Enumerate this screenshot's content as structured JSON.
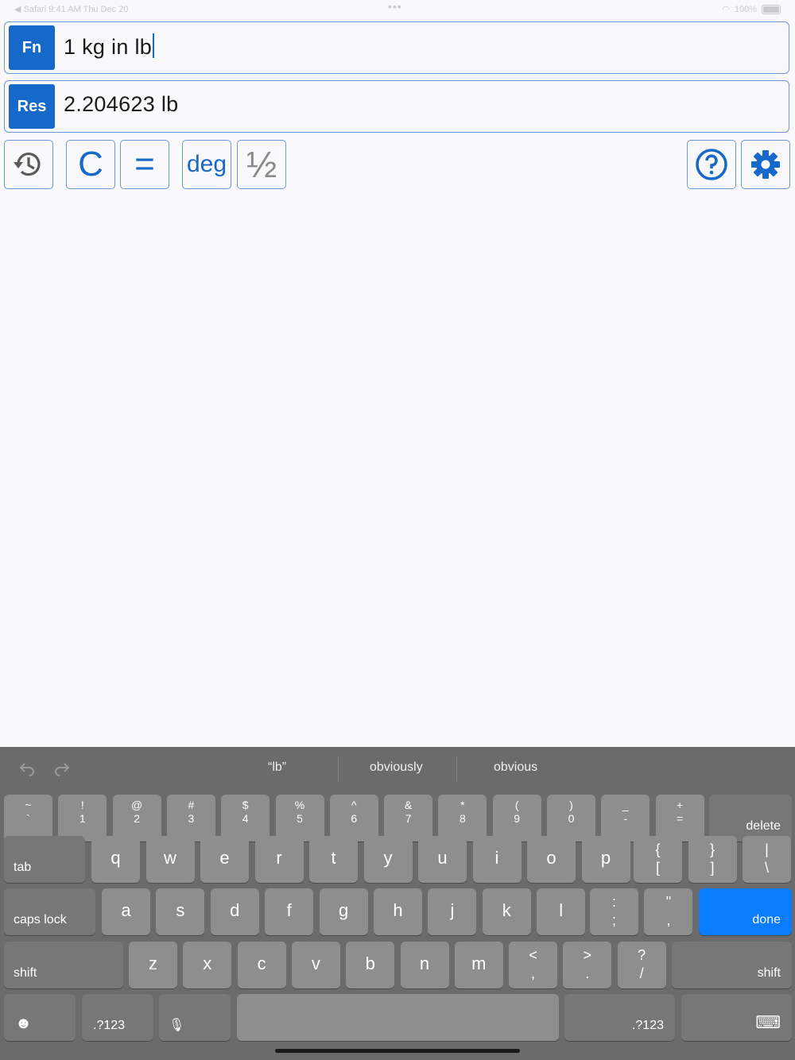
{
  "status": {
    "left": "◀ Safari  9:41 AM   Thu Dec 20",
    "right": "100%"
  },
  "fn": {
    "tag": "Fn",
    "value": "1 kg in lb"
  },
  "res": {
    "tag": "Res",
    "value": "2.204623 lb"
  },
  "toolbar": {
    "clear": "C",
    "equals": "=",
    "deg": "deg",
    "fraction": "½"
  },
  "keyboard": {
    "suggestions": [
      "“lb”",
      "obviously",
      "obvious"
    ],
    "num_row": [
      {
        "t": "~",
        "b": "`"
      },
      {
        "t": "!",
        "b": "1"
      },
      {
        "t": "@",
        "b": "2"
      },
      {
        "t": "#",
        "b": "3"
      },
      {
        "t": "$",
        "b": "4"
      },
      {
        "t": "%",
        "b": "5"
      },
      {
        "t": "^",
        "b": "6"
      },
      {
        "t": "&",
        "b": "7"
      },
      {
        "t": "*",
        "b": "8"
      },
      {
        "t": "(",
        "b": "9"
      },
      {
        "t": ")",
        "b": "0"
      },
      {
        "t": "_",
        "b": "-"
      },
      {
        "t": "+",
        "b": "="
      }
    ],
    "delete": "delete",
    "tab": "tab",
    "row_q": [
      "q",
      "w",
      "e",
      "r",
      "t",
      "y",
      "u",
      "i",
      "o",
      "p"
    ],
    "row_q_punct": [
      {
        "t": "{",
        "b": "["
      },
      {
        "t": "}",
        "b": "]"
      },
      {
        "t": "|",
        "b": "\\"
      }
    ],
    "caps": "caps lock",
    "row_a": [
      "a",
      "s",
      "d",
      "f",
      "g",
      "h",
      "j",
      "k",
      "l"
    ],
    "row_a_punct": [
      {
        "t": ":",
        "b": ";"
      },
      {
        "t": "\"",
        "b": ","
      }
    ],
    "done": "done",
    "shift": "shift",
    "row_z": [
      "z",
      "x",
      "c",
      "v",
      "b",
      "n",
      "m"
    ],
    "row_z_punct": [
      {
        "t": "<",
        "b": ","
      },
      {
        "t": ">",
        "b": "."
      },
      {
        "t": "?",
        "b": "/"
      }
    ],
    "num_switch": ".?123"
  }
}
